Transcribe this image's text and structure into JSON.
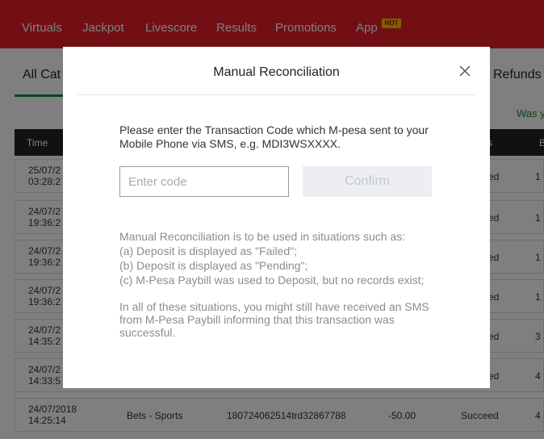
{
  "nav": {
    "items": [
      "Virtuals",
      "Jackpot",
      "Livescore",
      "Results",
      "Promotions",
      "App"
    ],
    "hot_badge": "HOT"
  },
  "background": {
    "tab_all": "All Cat",
    "tab_refunds": "Refunds",
    "was_text": "Was y",
    "headers": {
      "time": "Time",
      "status": "s",
      "balance": "B"
    },
    "rows": [
      {
        "time": "25/07/2\n03:28:2",
        "status": "ed",
        "balance": "1"
      },
      {
        "time": "24/07/2\n19:36:2",
        "status": "ed",
        "balance": "1"
      },
      {
        "time": "24/07/2\n19:36:2",
        "status": "ed",
        "balance": "1"
      },
      {
        "time": "24/07/2\n19:36:2",
        "status": "ed",
        "balance": "1"
      },
      {
        "time": "24/07/2\n14:35:2",
        "status": "ed",
        "balance": "3"
      },
      {
        "time": "24/07/2\n14:33:5",
        "status": "ed",
        "balance": "4"
      }
    ],
    "last_row": {
      "time": "24/07/2018\n14:25:14",
      "type": "Bets - Sports",
      "ref": "180724062514trd32867788",
      "amount": "-50.00",
      "status": "Succeed",
      "balance": "4"
    }
  },
  "modal": {
    "title": "Manual Reconciliation",
    "instruction": "Please enter the Transaction Code which M-pesa sent to your Mobile Phone via SMS, e.g. MDI3WSXXXX.",
    "input_placeholder": "Enter code",
    "input_value": "",
    "confirm_label": "Confirm",
    "help_lines": [
      "Manual Reconciliation is to be used in situations such as:",
      "(a) Deposit is displayed as \"Failed\";",
      "(b) Deposit is displayed as \"Pending\";",
      "(c) M-Pesa Paybill was used to Deposit, but no records exist;"
    ],
    "help_note": "In all of these situations, you might still have received an SMS from M-Pesa Paybill informing that this transaction was successful.",
    "close_icon": "close-icon"
  },
  "colors": {
    "brand_red": "#e41e2b",
    "accent_green": "#138a3a",
    "hot_yellow": "#f5c400"
  }
}
